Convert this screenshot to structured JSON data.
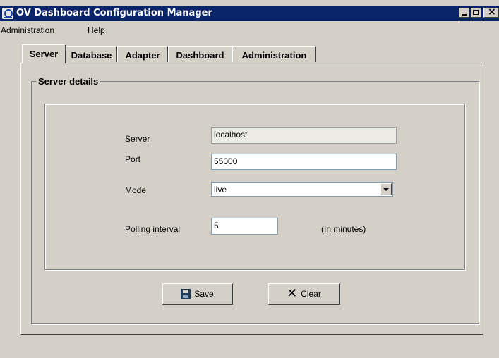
{
  "window": {
    "title": "OV Dashboard Configuration Manager",
    "close_glyph": "×"
  },
  "menubar": {
    "items": [
      "Administration",
      "Help"
    ]
  },
  "tabs": {
    "items": [
      "Server",
      "Database",
      "Adapter",
      "Dashboard",
      "Administration"
    ],
    "active": "Server"
  },
  "server_details": {
    "group_title": "Server details",
    "server_label": "Server",
    "server_value": "localhost",
    "port_label": "Port",
    "port_value": "55000",
    "mode_label": "Mode",
    "mode_value": "live",
    "polling_label": "Polling interval",
    "polling_value": "5",
    "polling_unit": "(In minutes)"
  },
  "buttons": {
    "save": "Save",
    "clear": "Clear",
    "clear_glyph": "✕"
  },
  "icons": {
    "app": "app-icon",
    "save": "floppy-disk-icon",
    "clear": "x-icon"
  }
}
